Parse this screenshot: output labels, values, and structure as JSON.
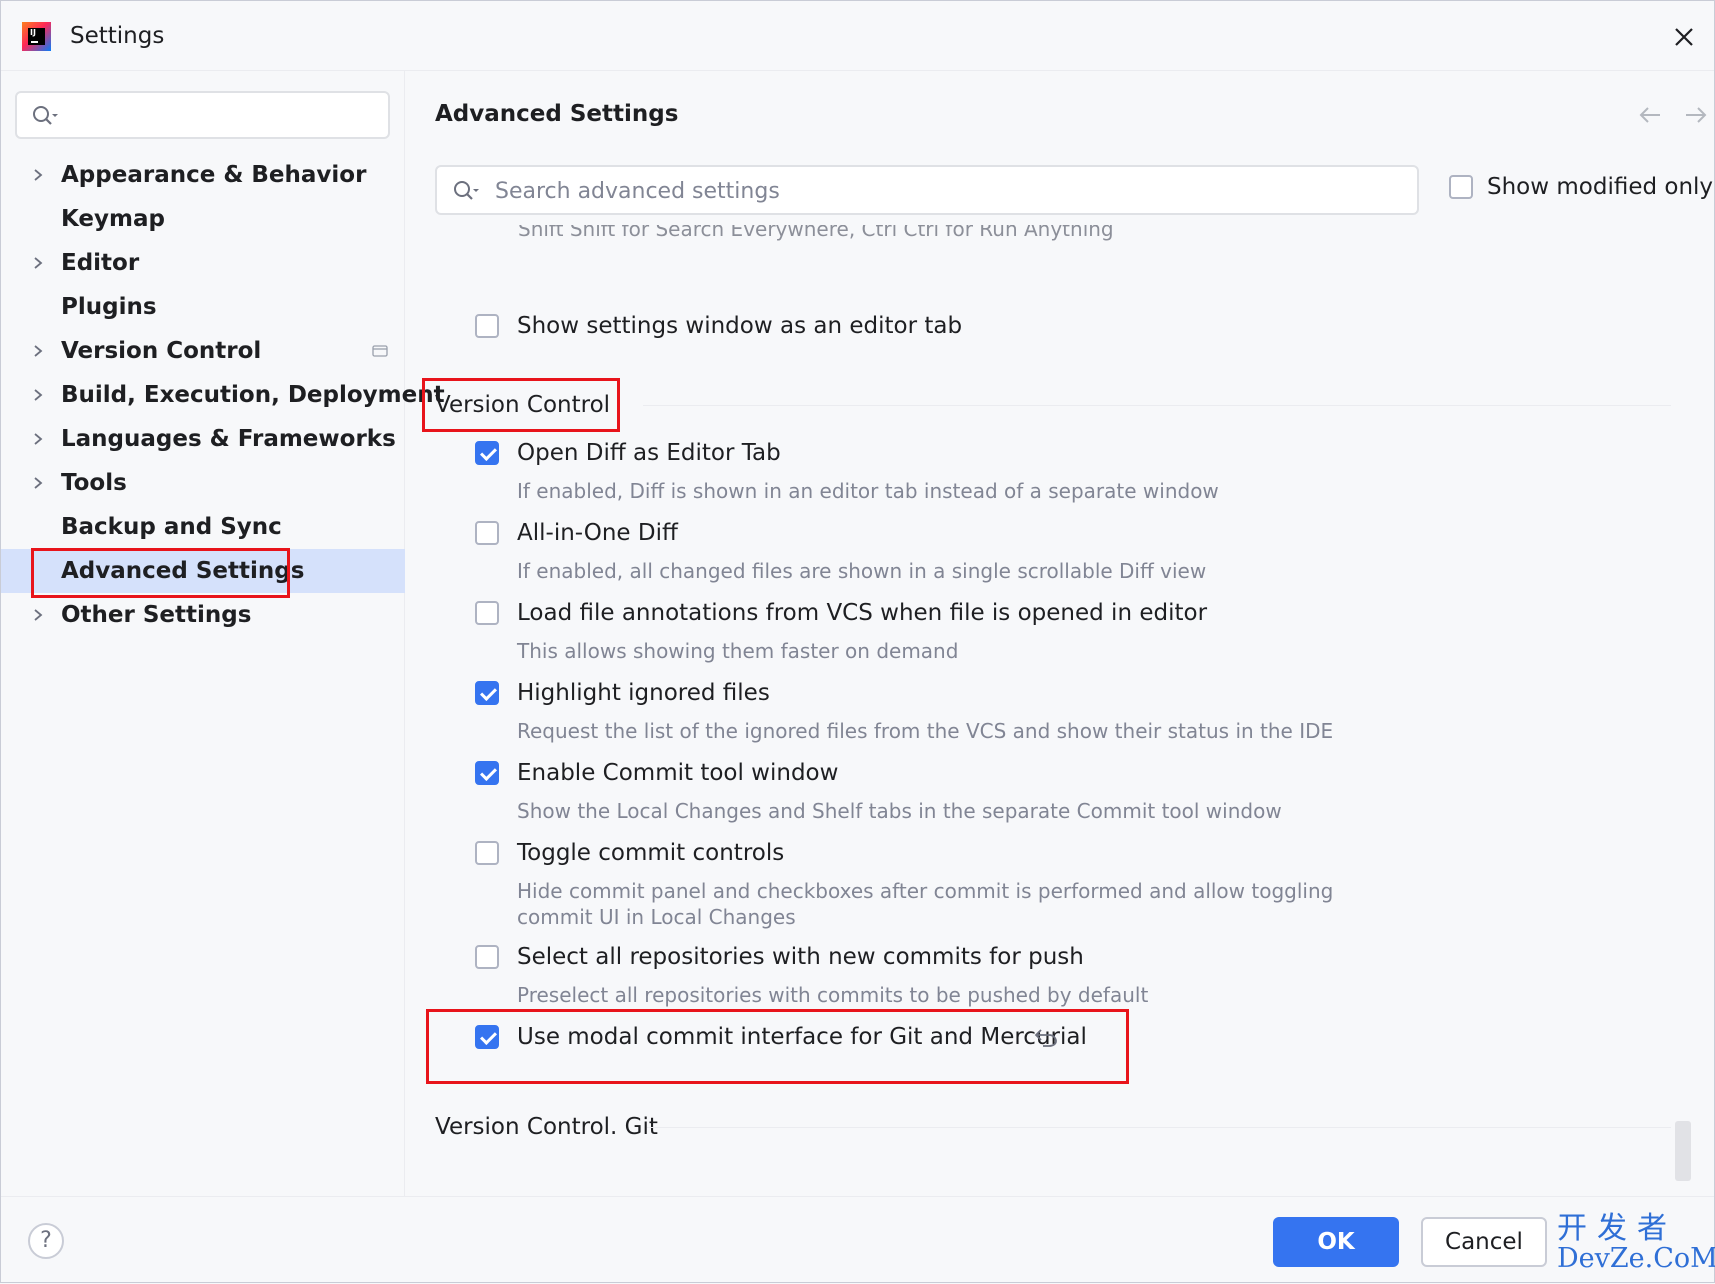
{
  "window": {
    "title": "Settings"
  },
  "sidebar": {
    "search_placeholder": "",
    "items": [
      {
        "label": "Appearance & Behavior",
        "expandable": true
      },
      {
        "label": "Keymap",
        "expandable": false
      },
      {
        "label": "Editor",
        "expandable": true
      },
      {
        "label": "Plugins",
        "expandable": false
      },
      {
        "label": "Version Control",
        "expandable": true
      },
      {
        "label": "Build, Execution, Deployment",
        "expandable": true
      },
      {
        "label": "Languages & Frameworks",
        "expandable": true
      },
      {
        "label": "Tools",
        "expandable": true
      },
      {
        "label": "Backup and Sync",
        "expandable": false
      },
      {
        "label": "Advanced Settings",
        "expandable": false,
        "selected": true
      },
      {
        "label": "Other Settings",
        "expandable": true
      }
    ]
  },
  "main": {
    "title": "Advanced Settings",
    "search_placeholder": "Search advanced settings",
    "show_modified_only": {
      "label": "Show modified only",
      "checked": false
    },
    "clipped_text": "Shift Shift for Search Everywhere, Ctrl Ctrl for Run Anything",
    "top_option": {
      "label": "Show settings window as an editor tab",
      "checked": false
    },
    "sections": [
      {
        "title": "Version Control",
        "options": [
          {
            "label": "Open Diff as Editor Tab",
            "checked": true,
            "description": "If enabled, Diff is shown in an editor tab instead of a separate window"
          },
          {
            "label": "All-in-One Diff",
            "checked": false,
            "description": "If enabled, all changed files are shown in a single scrollable Diff view"
          },
          {
            "label": "Load file annotations from VCS when file is opened in editor",
            "checked": false,
            "description": "This allows showing them faster on demand"
          },
          {
            "label": "Highlight ignored files",
            "checked": true,
            "description": "Request the list of the ignored files from the VCS and show their status in the IDE"
          },
          {
            "label": "Enable Commit tool window",
            "checked": true,
            "description": "Show the Local Changes and Shelf tabs in the separate Commit tool window"
          },
          {
            "label": "Toggle commit controls",
            "checked": false,
            "description": "Hide commit panel and checkboxes after commit is performed and allow toggling commit UI in Local Changes"
          },
          {
            "label": "Select all repositories with new commits for push",
            "checked": false,
            "description": "Preselect all repositories with commits to be pushed by default"
          },
          {
            "label": "Use modal commit interface for Git and Mercurial",
            "checked": true,
            "description": "",
            "modified": true
          }
        ]
      },
      {
        "title": "Version Control. Git",
        "options": []
      }
    ]
  },
  "footer": {
    "help_label": "?",
    "ok_label": "OK",
    "cancel_label": "Cancel",
    "watermark_top": "开发者",
    "watermark_bottom": "DevZe.CoM"
  },
  "colors": {
    "accent": "#3574f0",
    "selection": "#d5e1fb",
    "highlight_box": "#e8141b",
    "background": "#f7f8fa",
    "description_text": "#818594"
  },
  "icons": [
    "app-logo",
    "close-icon",
    "search-icon",
    "chevron-right-icon",
    "vcs-project-icon",
    "back-arrow-icon",
    "forward-arrow-icon",
    "revert-icon",
    "help-icon"
  ]
}
